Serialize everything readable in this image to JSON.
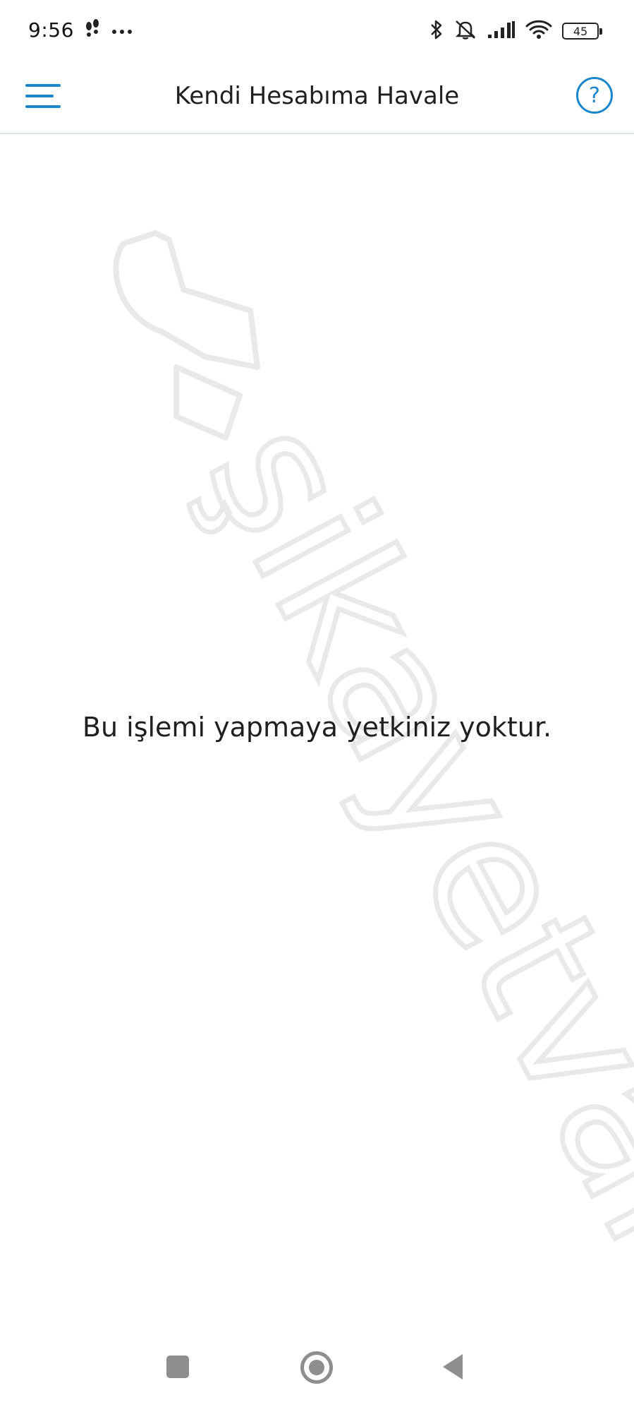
{
  "status_bar": {
    "time": "9:56",
    "left_icons": [
      "walking-icon",
      "more-dots-icon"
    ],
    "right_icons": [
      "bluetooth-icon",
      "muted-bell-icon",
      "signal-icon",
      "wifi-icon"
    ],
    "battery_level": "45"
  },
  "header": {
    "title": "Kendi Hesabıma Havale",
    "menu_icon": "hamburger-menu-icon",
    "help_label": "?",
    "accent_color": "#1a86cc"
  },
  "main": {
    "message": "Bu işlemi yapmaya yetkiniz yoktur."
  },
  "watermark": {
    "text": "şikayetvar"
  },
  "nav_bar": {
    "icons": [
      "recents-icon",
      "home-icon",
      "back-icon"
    ]
  }
}
